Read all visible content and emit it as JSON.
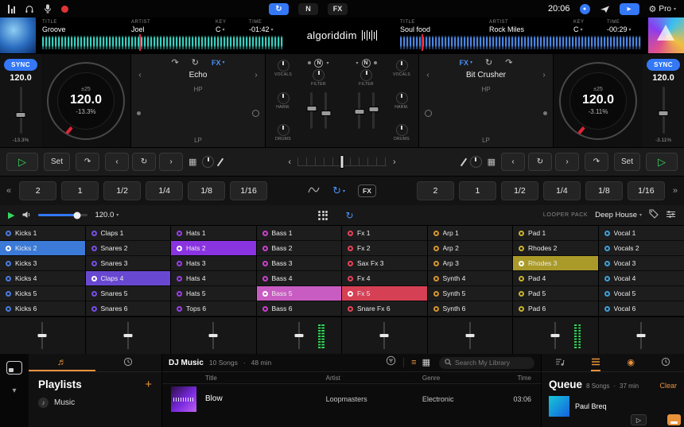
{
  "topbar": {
    "time": "20:06",
    "pro_label": "Pro",
    "neural_label": "N",
    "fx_label": "FX"
  },
  "logo_text": "algoriddim",
  "colors": {
    "accent_blue": "#3478f6",
    "accent_orange": "#e8923a",
    "play_green": "#38d65e",
    "record_red": "#e03434",
    "playhead_red": "#e0243a"
  },
  "decks": {
    "left": {
      "title_label": "TITLE",
      "title": "Groove",
      "artist_label": "ARTIST",
      "artist": "Joel",
      "key_label": "KEY",
      "key": "C",
      "time_label": "TIME",
      "time_remaining": "-01:42",
      "sync_label": "SYNC",
      "tempo": "120.0",
      "pitch_range": "±25",
      "bpm": "120.0",
      "pitch_percent": "-13.3%"
    },
    "right": {
      "title_label": "TITLE",
      "title": "Soul food",
      "artist_label": "ARTIST",
      "artist": "Rock Miles",
      "key_label": "KEY",
      "key": "C",
      "time_label": "TIME",
      "time_remaining": "-00:29",
      "sync_label": "SYNC",
      "tempo": "120.0",
      "pitch_range": "±25",
      "bpm": "120.0",
      "pitch_percent": "-3.11%"
    }
  },
  "fx": {
    "left": {
      "header_label": "FX",
      "name": "Echo",
      "hp_label": "HP",
      "lp_label": "LP"
    },
    "right": {
      "header_label": "FX",
      "name": "Bit Crusher",
      "hp_label": "HP",
      "lp_label": "LP"
    }
  },
  "mixer": {
    "vocals_label": "VOCALS",
    "harm_label": "HARM.",
    "drums_label": "DRUMS",
    "filter_label": "FILTER",
    "neural_label": "N"
  },
  "transport": {
    "set_label": "Set"
  },
  "beat_buttons": [
    "2",
    "1",
    "1/2",
    "1/4",
    "1/8",
    "1/16"
  ],
  "beat_fx_label": "FX",
  "looper": {
    "bpm": "120.0",
    "pack_label": "LOOPER PACK",
    "pack_name": "Deep House",
    "columns": [
      {
        "color": "#4a7be0",
        "cells": [
          {
            "label": "Kicks 1"
          },
          {
            "label": "Kicks 2",
            "active": true,
            "bg": "#3c7ad8"
          },
          {
            "label": "Kicks 3"
          },
          {
            "label": "Kicks 4"
          },
          {
            "label": "Kicks 5"
          },
          {
            "label": "Kicks 6"
          }
        ]
      },
      {
        "color": "#7750e0",
        "cells": [
          {
            "label": "Claps 1"
          },
          {
            "label": "Snares 2"
          },
          {
            "label": "Snares 3"
          },
          {
            "label": "Claps 4",
            "active": true,
            "bg": "#6848d0"
          },
          {
            "label": "Snares 5"
          },
          {
            "label": "Snares 6"
          }
        ]
      },
      {
        "color": "#9a3fe8",
        "cells": [
          {
            "label": "Hats 1"
          },
          {
            "label": "Hats 2",
            "active": true,
            "bg": "#8a33e0"
          },
          {
            "label": "Hats 3"
          },
          {
            "label": "Hats 4"
          },
          {
            "label": "Hats 5"
          },
          {
            "label": "Tops 6"
          }
        ]
      },
      {
        "color": "#cc3fd0",
        "meter": true,
        "cells": [
          {
            "label": "Bass 1"
          },
          {
            "label": "Bass 2"
          },
          {
            "label": "Bass 3"
          },
          {
            "label": "Bass 4"
          },
          {
            "label": "Bass 5",
            "active": true,
            "bg": "#c95cc2"
          },
          {
            "label": "Bass 6"
          }
        ]
      },
      {
        "color": "#e84358",
        "cells": [
          {
            "label": "Fx 1"
          },
          {
            "label": "Fx 2"
          },
          {
            "label": "Sax Fx 3"
          },
          {
            "label": "Fx 4"
          },
          {
            "label": "Fx 5",
            "active": true,
            "bg": "#d64055"
          },
          {
            "label": "Snare Fx 6"
          }
        ]
      },
      {
        "color": "#d4952f",
        "cells": [
          {
            "label": "Arp 1"
          },
          {
            "label": "Arp 2"
          },
          {
            "label": "Arp 3"
          },
          {
            "label": "Synth 4"
          },
          {
            "label": "Synth 5"
          },
          {
            "label": "Synth 6"
          }
        ]
      },
      {
        "color": "#c9b42e",
        "meter": true,
        "cells": [
          {
            "label": "Pad 1"
          },
          {
            "label": "Rhodes 2"
          },
          {
            "label": "Rhodes 3",
            "active": true,
            "bg": "#a99a29"
          },
          {
            "label": "Pad 4"
          },
          {
            "label": "Pad 5"
          },
          {
            "label": "Pad 6"
          }
        ]
      },
      {
        "color": "#3f9fd9",
        "cells": [
          {
            "label": "Vocal 1"
          },
          {
            "label": "Vocals 2"
          },
          {
            "label": "Vocal 3"
          },
          {
            "label": "Vocal 4"
          },
          {
            "label": "Vocal 5"
          },
          {
            "label": "Vocal 6"
          }
        ]
      }
    ]
  },
  "library": {
    "source_name": "DJ Music",
    "songs_count": "10 Songs",
    "total_duration": "48 min",
    "meta_separator": "·",
    "search_placeholder": "Search My Library",
    "columns": {
      "title": "Title",
      "artist": "Artist",
      "genre": "Genre",
      "time": "Time"
    },
    "rows": [
      {
        "title": "Blow",
        "artist": "Loopmasters",
        "genre": "Electronic",
        "time": "03:06"
      }
    ],
    "playlists": {
      "header": "Playlists",
      "add_label": "+",
      "items": [
        {
          "label": "Music"
        }
      ]
    },
    "queue": {
      "header": "Queue",
      "songs_count": "8 Songs",
      "total_duration": "37 min",
      "clear_label": "Clear",
      "first_item_title": "Paul Breq"
    }
  }
}
